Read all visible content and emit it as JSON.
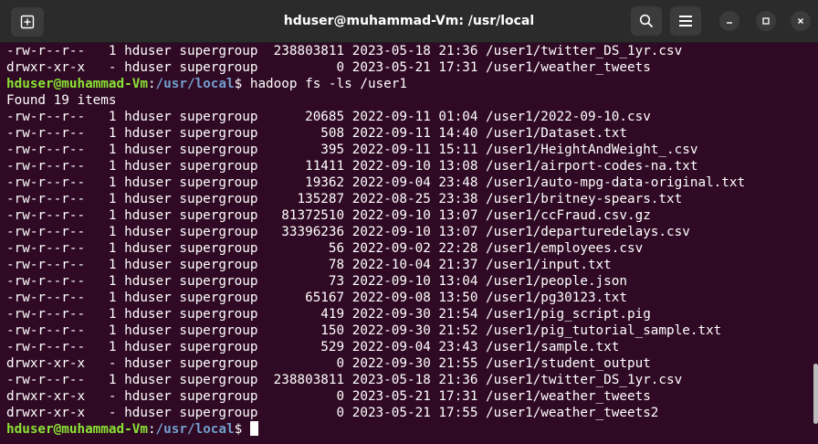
{
  "window": {
    "title": "hduser@muhammad-Vm: /usr/local"
  },
  "icons": {
    "new_tab": "new-tab-icon",
    "search": "search-icon",
    "menu": "hamburger-menu-icon",
    "minimize": "minimize-icon",
    "maximize": "maximize-icon",
    "close": "close-icon"
  },
  "colors": {
    "background": "#300a24",
    "prompt_user": "#8ae234",
    "prompt_path": "#729fcf",
    "text": "#ffffff"
  },
  "terminal": {
    "lines": [
      "-rw-r--r--   1 hduser supergroup  238803811 2023-05-18 21:36 /user1/twitter_DS_1yr.csv",
      "drwxr-xr-x   - hduser supergroup          0 2023-05-21 17:31 /user1/weather_tweets",
      {
        "user": "hduser@muhammad-Vm",
        "sep": ":",
        "path": "/usr/local",
        "cmd": "$ hadoop fs -ls /user1"
      },
      "Found 19 items",
      "-rw-r--r--   1 hduser supergroup      20685 2022-09-11 01:04 /user1/2022-09-10.csv",
      "-rw-r--r--   1 hduser supergroup        508 2022-09-11 14:40 /user1/Dataset.txt",
      "-rw-r--r--   1 hduser supergroup        395 2022-09-11 15:11 /user1/HeightAndWeight_.csv",
      "-rw-r--r--   1 hduser supergroup      11411 2022-09-10 13:08 /user1/airport-codes-na.txt",
      "-rw-r--r--   1 hduser supergroup      19362 2022-09-04 23:48 /user1/auto-mpg-data-original.txt",
      "-rw-r--r--   1 hduser supergroup     135287 2022-08-25 23:38 /user1/britney-spears.txt",
      "-rw-r--r--   1 hduser supergroup   81372510 2022-09-10 13:07 /user1/ccFraud.csv.gz",
      "-rw-r--r--   1 hduser supergroup   33396236 2022-09-10 13:07 /user1/departuredelays.csv",
      "-rw-r--r--   1 hduser supergroup         56 2022-09-02 22:28 /user1/employees.csv",
      "-rw-r--r--   1 hduser supergroup         78 2022-10-04 21:37 /user1/input.txt",
      "-rw-r--r--   1 hduser supergroup         73 2022-09-10 13:04 /user1/people.json",
      "-rw-r--r--   1 hduser supergroup      65167 2022-09-08 13:50 /user1/pg30123.txt",
      "-rw-r--r--   1 hduser supergroup        419 2022-09-30 21:54 /user1/pig_script.pig",
      "-rw-r--r--   1 hduser supergroup        150 2022-09-30 21:52 /user1/pig_tutorial_sample.txt",
      "-rw-r--r--   1 hduser supergroup        529 2022-09-04 23:43 /user1/sample.txt",
      "drwxr-xr-x   - hduser supergroup          0 2022-09-30 21:55 /user1/student_output",
      "-rw-r--r--   1 hduser supergroup  238803811 2023-05-18 21:36 /user1/twitter_DS_1yr.csv",
      "drwxr-xr-x   - hduser supergroup          0 2023-05-21 17:31 /user1/weather_tweets",
      "drwxr-xr-x   - hduser supergroup          0 2023-05-21 17:55 /user1/weather_tweets2",
      {
        "user": "hduser@muhammad-Vm",
        "sep": ":",
        "path": "/usr/local",
        "cmd": "$ ",
        "cursor": true
      }
    ]
  }
}
